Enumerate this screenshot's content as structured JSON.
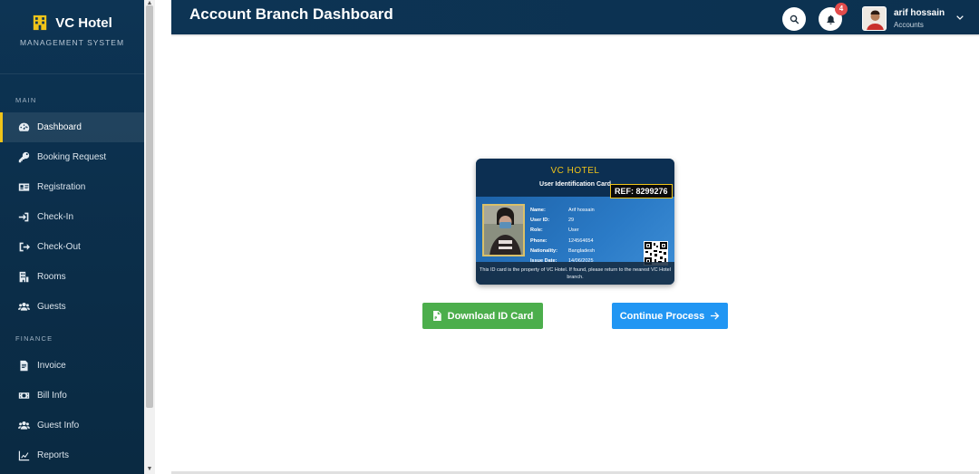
{
  "brand": {
    "name": "VC Hotel",
    "subtitle": "MANAGEMENT SYSTEM"
  },
  "sidebar": {
    "sections": [
      {
        "label": "MAIN"
      },
      {
        "label": "FINANCE"
      }
    ],
    "main_items": [
      {
        "label": "Dashboard",
        "icon": "dashboard-icon",
        "active": true
      },
      {
        "label": "Booking Request",
        "icon": "key-icon"
      },
      {
        "label": "Registration",
        "icon": "id-card-icon"
      },
      {
        "label": "Check-In",
        "icon": "sign-in-icon"
      },
      {
        "label": "Check-Out",
        "icon": "sign-out-icon"
      },
      {
        "label": "Rooms",
        "icon": "building-icon"
      },
      {
        "label": "Guests",
        "icon": "users-icon"
      }
    ],
    "finance_items": [
      {
        "label": "Invoice",
        "icon": "file-invoice-icon"
      },
      {
        "label": "Bill Info",
        "icon": "money-bill-icon"
      },
      {
        "label": "Guest Info",
        "icon": "users-icon"
      },
      {
        "label": "Reports",
        "icon": "chart-line-icon"
      }
    ]
  },
  "header": {
    "title": "Account Branch Dashboard",
    "notification_count": "4",
    "user": {
      "name": "arif hossain",
      "role": "Accounts"
    }
  },
  "id_card": {
    "hotel": "VC HOTEL",
    "subtitle": "User Identification Card",
    "ref": "REF: 8299276",
    "fields": [
      {
        "label": "Name:",
        "value": "Arif hossain"
      },
      {
        "label": "User ID:",
        "value": "29"
      },
      {
        "label": "Role:",
        "value": "User"
      },
      {
        "label": "Phone:",
        "value": "124564654"
      },
      {
        "label": "Nationality:",
        "value": "Bangladesh"
      },
      {
        "label": "Issue Date:",
        "value": "14/06/2025"
      }
    ],
    "footer": "This ID card is the property of VC Hotel. If found, please return to the nearest VC Hotel branch."
  },
  "actions": {
    "download_label": "Download ID Card",
    "continue_label": "Continue Process"
  },
  "colors": {
    "sidebar_bg": "#0d3454",
    "accent_yellow": "#f0c419",
    "download_green": "#4cae4c",
    "continue_blue": "#2196f3",
    "badge_red": "#e24b4b"
  }
}
